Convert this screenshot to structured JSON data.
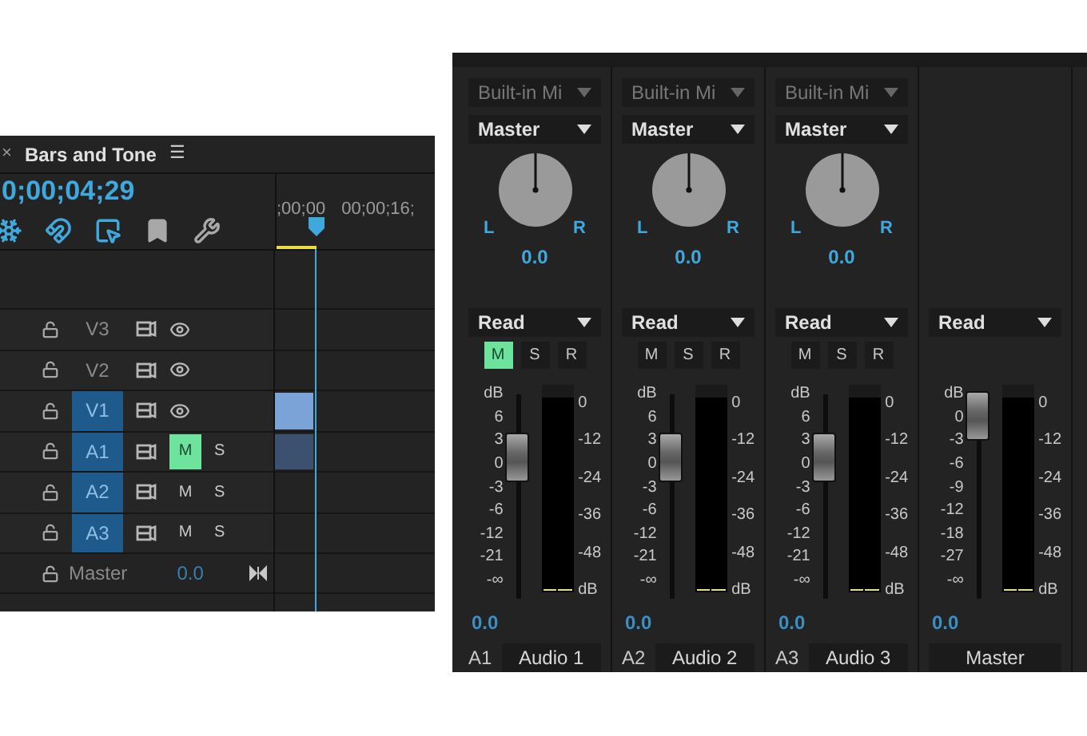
{
  "timeline": {
    "close": "×",
    "title": "Bars and Tone",
    "menu": "☰",
    "timecode": "0;00;04;29",
    "ruler_labels": [
      ";00;00",
      "00;00;16;"
    ],
    "tools": [
      {
        "kind": "nest",
        "on": true
      },
      {
        "kind": "snap",
        "on": true
      },
      {
        "kind": "linked",
        "on": true
      },
      {
        "kind": "marker",
        "on": false
      },
      {
        "kind": "settings",
        "on": false
      }
    ],
    "tracks": [
      {
        "name": "V3",
        "kind": "video",
        "targeted": false,
        "clip": false
      },
      {
        "name": "V2",
        "kind": "video",
        "targeted": false,
        "clip": false
      },
      {
        "name": "V1",
        "kind": "video",
        "targeted": true,
        "clip": true
      },
      {
        "name": "A1",
        "kind": "audio",
        "targeted": true,
        "clip": true,
        "mute_label": "M",
        "solo_label": "S",
        "muted": true
      },
      {
        "name": "A2",
        "kind": "audio",
        "targeted": true,
        "clip": false,
        "mute_label": "M",
        "solo_label": "S",
        "muted": false
      },
      {
        "name": "A3",
        "kind": "audio",
        "targeted": true,
        "clip": false,
        "mute_label": "M",
        "solo_label": "S",
        "muted": false
      }
    ],
    "master": {
      "name": "Master",
      "value": "0.0"
    }
  },
  "mixer": {
    "channels": [
      {
        "kind": "track",
        "input": "Built-in Mi",
        "output": "Master",
        "pan_left": "L",
        "pan_right": "R",
        "pan": "0.0",
        "mode": "Read",
        "mute_label": "M",
        "solo_label": "S",
        "record_label": "R",
        "muted": true,
        "fader_scale": [
          "dB",
          "6",
          "3",
          "0",
          "-3",
          "-6",
          "-12",
          "-21",
          "-∞"
        ],
        "level": 0.74,
        "meter_scale": [
          "0",
          "-12",
          "-24",
          "-36",
          "-48",
          "dB"
        ],
        "volume": "0.0",
        "id": "A1",
        "name": "Audio 1"
      },
      {
        "kind": "track",
        "input": "Built-in Mi",
        "output": "Master",
        "pan_left": "L",
        "pan_right": "R",
        "pan": "0.0",
        "mode": "Read",
        "mute_label": "M",
        "solo_label": "S",
        "record_label": "R",
        "muted": false,
        "fader_scale": [
          "dB",
          "6",
          "3",
          "0",
          "-3",
          "-6",
          "-12",
          "-21",
          "-∞"
        ],
        "level": 0.74,
        "meter_scale": [
          "0",
          "-12",
          "-24",
          "-36",
          "-48",
          "dB"
        ],
        "volume": "0.0",
        "id": "A2",
        "name": "Audio 2"
      },
      {
        "kind": "track",
        "input": "Built-in Mi",
        "output": "Master",
        "pan_left": "L",
        "pan_right": "R",
        "pan": "0.0",
        "mode": "Read",
        "mute_label": "M",
        "solo_label": "S",
        "record_label": "R",
        "muted": false,
        "fader_scale": [
          "dB",
          "6",
          "3",
          "0",
          "-3",
          "-6",
          "-12",
          "-21",
          "-∞"
        ],
        "level": 0.74,
        "meter_scale": [
          "0",
          "-12",
          "-24",
          "-36",
          "-48",
          "dB"
        ],
        "volume": "0.0",
        "id": "A3",
        "name": "Audio 3"
      },
      {
        "kind": "master",
        "mode": "Read",
        "fader_scale": [
          "dB",
          "0",
          "-3",
          "-6",
          "-9",
          "-12",
          "-18",
          "-27",
          "-∞"
        ],
        "level": 1,
        "meter_scale": [
          "0",
          "-12",
          "-24",
          "-36",
          "-48",
          "dB"
        ],
        "volume": "0.0",
        "name": "Master"
      }
    ]
  }
}
